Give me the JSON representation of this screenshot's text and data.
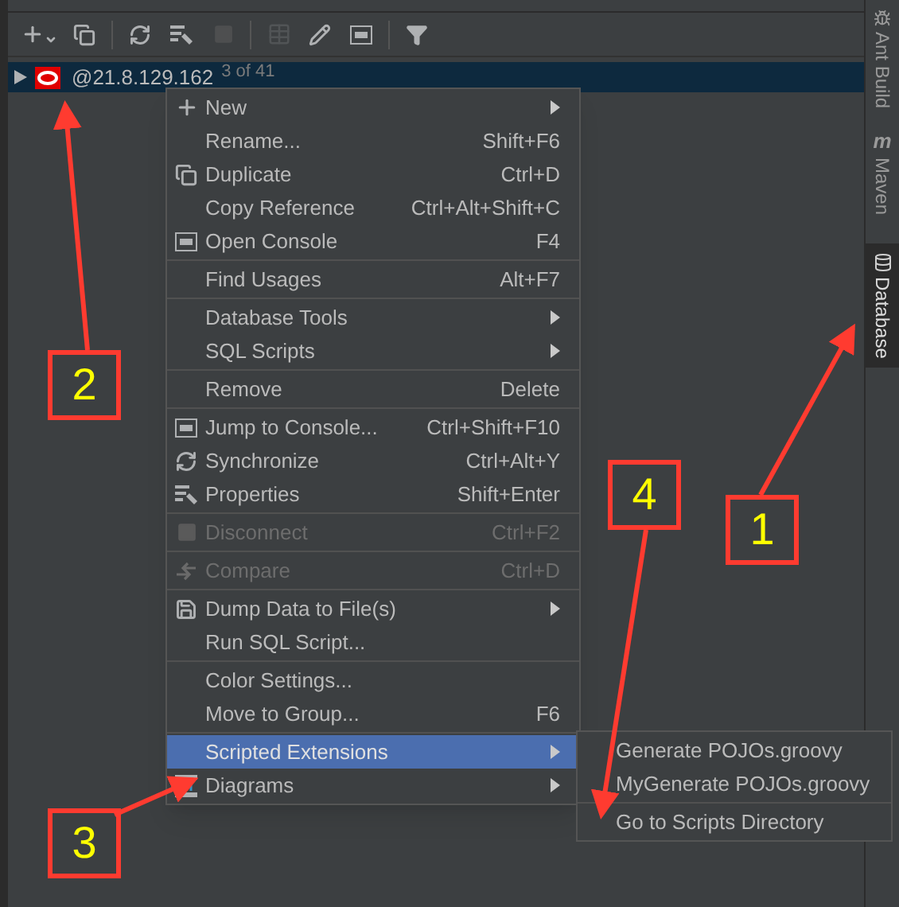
{
  "toolbar": {
    "buttons": [
      {
        "kind": "button",
        "disabled": false
      },
      {
        "kind": "button",
        "disabled": false
      },
      {
        "kind": "separator"
      },
      {
        "kind": "button",
        "disabled": false
      },
      {
        "kind": "button",
        "disabled": false
      },
      {
        "kind": "button",
        "disabled": true
      },
      {
        "kind": "separator"
      },
      {
        "kind": "button",
        "disabled": true
      },
      {
        "kind": "button",
        "disabled": false
      },
      {
        "kind": "button",
        "disabled": false
      },
      {
        "kind": "separator"
      },
      {
        "kind": "button",
        "disabled": false
      }
    ]
  },
  "tree": {
    "rows": [
      {
        "label": "@21.8.129.162",
        "detail": "3 of 41",
        "selected": true,
        "expanded": false
      }
    ]
  },
  "context_menu": {
    "items": [
      {
        "kind": "item",
        "label": "New",
        "submenu": true,
        "selected": false,
        "disabled": false
      },
      {
        "kind": "item",
        "label": "Rename...",
        "shortcut": "Shift+F6",
        "submenu": false,
        "selected": false,
        "disabled": false
      },
      {
        "kind": "item",
        "label": "Duplicate",
        "shortcut": "Ctrl+D",
        "submenu": false,
        "selected": false,
        "disabled": false
      },
      {
        "kind": "item",
        "label": "Copy Reference",
        "shortcut": "Ctrl+Alt+Shift+C",
        "submenu": false,
        "selected": false,
        "disabled": false
      },
      {
        "kind": "item",
        "label": "Open Console",
        "shortcut": "F4",
        "submenu": false,
        "selected": false,
        "disabled": false
      },
      {
        "kind": "separator"
      },
      {
        "kind": "item",
        "label": "Find Usages",
        "shortcut": "Alt+F7",
        "submenu": false,
        "selected": false,
        "disabled": false
      },
      {
        "kind": "separator"
      },
      {
        "kind": "item",
        "label": "Database Tools",
        "submenu": true,
        "selected": false,
        "disabled": false
      },
      {
        "kind": "item",
        "label": "SQL Scripts",
        "submenu": true,
        "selected": false,
        "disabled": false
      },
      {
        "kind": "separator"
      },
      {
        "kind": "item",
        "label": "Remove",
        "shortcut": "Delete",
        "submenu": false,
        "selected": false,
        "disabled": false
      },
      {
        "kind": "separator"
      },
      {
        "kind": "item",
        "label": "Jump to Console...",
        "shortcut": "Ctrl+Shift+F10",
        "submenu": false,
        "selected": false,
        "disabled": false
      },
      {
        "kind": "item",
        "label": "Synchronize",
        "shortcut": "Ctrl+Alt+Y",
        "submenu": false,
        "selected": false,
        "disabled": false
      },
      {
        "kind": "item",
        "label": "Properties",
        "shortcut": "Shift+Enter",
        "submenu": false,
        "selected": false,
        "disabled": false
      },
      {
        "kind": "separator"
      },
      {
        "kind": "item",
        "label": "Disconnect",
        "shortcut": "Ctrl+F2",
        "submenu": false,
        "selected": false,
        "disabled": true
      },
      {
        "kind": "separator"
      },
      {
        "kind": "item",
        "label": "Compare",
        "shortcut": "Ctrl+D",
        "submenu": false,
        "selected": false,
        "disabled": true
      },
      {
        "kind": "separator"
      },
      {
        "kind": "item",
        "label": "Dump Data to File(s)",
        "submenu": true,
        "selected": false,
        "disabled": false
      },
      {
        "kind": "item",
        "label": "Run SQL Script...",
        "submenu": false,
        "selected": false,
        "disabled": false
      },
      {
        "kind": "separator"
      },
      {
        "kind": "item",
        "label": "Color Settings...",
        "submenu": false,
        "selected": false,
        "disabled": false
      },
      {
        "kind": "item",
        "label": "Move to Group...",
        "shortcut": "F6",
        "submenu": false,
        "selected": false,
        "disabled": false
      },
      {
        "kind": "separator"
      },
      {
        "kind": "item",
        "label": "Scripted Extensions",
        "submenu": true,
        "selected": true,
        "disabled": false
      },
      {
        "kind": "item",
        "label": "Diagrams",
        "submenu": true,
        "selected": false,
        "disabled": false
      }
    ]
  },
  "submenu": {
    "items": [
      {
        "kind": "item",
        "label": "Generate POJOs.groovy",
        "selected": false,
        "disabled": false
      },
      {
        "kind": "item",
        "label": "MyGenerate POJOs.groovy",
        "selected": false,
        "disabled": false
      },
      {
        "kind": "separator"
      },
      {
        "kind": "item",
        "label": "Go to Scripts Directory",
        "selected": false,
        "disabled": false
      }
    ]
  },
  "side_tabs": [
    {
      "label": "Ant Build",
      "selected": false
    },
    {
      "glyph": "m",
      "label": "Maven",
      "selected": false
    },
    {
      "label": "Database",
      "selected": true
    }
  ],
  "annotations": [
    {
      "label": "1"
    },
    {
      "label": "2"
    },
    {
      "label": "3"
    },
    {
      "label": "4"
    }
  ]
}
